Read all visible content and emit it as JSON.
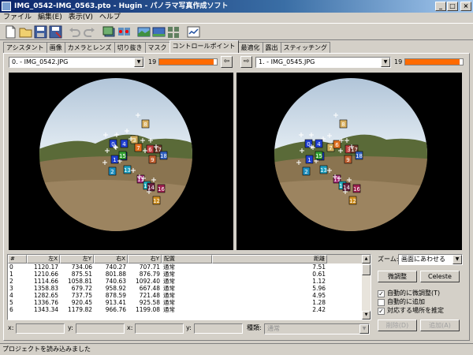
{
  "window": {
    "title": "IMG_0542-IMG_0563.pto - Hugin - パノラマ写真作成ソフト",
    "minimize": "_",
    "maximize": "□",
    "close": "×"
  },
  "menu": [
    "ファイル",
    "編集(E)",
    "表示(V)",
    "ヘルプ"
  ],
  "toolbar": [
    "new-project",
    "open-project",
    "save-project",
    "save-as",
    "undo",
    "redo",
    "add-image",
    "control-points",
    "panorama-preview",
    "fast-preview",
    "layout",
    "stitch"
  ],
  "tabs": [
    "アシスタント",
    "画像",
    "カメラとレンズ",
    "切り抜き",
    "マスク",
    "コントロールポイント",
    "最適化",
    "露出",
    "スティッチング"
  ],
  "active_tab": "コントロールポイント",
  "left_image": {
    "select": "0. - IMG_0542.JPG",
    "count": "19",
    "progress": 0.95,
    "nav": "⇦"
  },
  "right_image": {
    "select": "1. - IMG_0545.JPG",
    "count": "19",
    "progress": 0.95,
    "nav": "⇨"
  },
  "points_left": [
    "8",
    "0",
    "4",
    "3",
    "7",
    "6",
    "17",
    "5",
    "1",
    "18",
    "9",
    "2",
    "13",
    "11",
    "10",
    "14",
    "16",
    "12",
    "15"
  ],
  "points_right": [
    "8",
    "0",
    "4",
    "7",
    "6",
    "3",
    "17",
    "5",
    "1",
    "18",
    "9",
    "2",
    "13",
    "11",
    "10",
    "14",
    "16",
    "12",
    "15"
  ],
  "table": {
    "headers": [
      "#",
      "左X",
      "左Y",
      "右X",
      "右Y",
      "配置",
      "距離"
    ],
    "rows": [
      [
        "0",
        "1120.17",
        "734.06",
        "740.27",
        "707.71",
        "通常",
        "7.51"
      ],
      [
        "1",
        "1210.66",
        "875.51",
        "801.88",
        "876.79",
        "通常",
        "0.61"
      ],
      [
        "2",
        "1114.66",
        "1058.81",
        "740.63",
        "1092.40",
        "通常",
        "1.12"
      ],
      [
        "3",
        "1358.83",
        "679.72",
        "958.92",
        "667.48",
        "通常",
        "5.96"
      ],
      [
        "4",
        "1282.65",
        "737.75",
        "878.59",
        "721.48",
        "通常",
        "4.95"
      ],
      [
        "5",
        "1336.76",
        "920.45",
        "913.41",
        "925.58",
        "通常",
        "1.28"
      ],
      [
        "6",
        "1343.34",
        "1179.82",
        "966.76",
        "1199.08",
        "通常",
        "2.42"
      ]
    ]
  },
  "fields": {
    "x1": "x:",
    "y1": "y:",
    "x2": "x:",
    "y2": "y:",
    "type_label": "種類:",
    "type_value": "通常"
  },
  "side": {
    "zoom_label": "ズーム:",
    "zoom_value": "画面にあわせる",
    "fine_tune": "微調整",
    "celeste": "Celeste",
    "auto_fine_tune": "自動的に微調整(T)",
    "auto_fine_tune_checked": true,
    "auto_add": "自動的に追加",
    "auto_add_checked": false,
    "estimate": "対応する場所を推定",
    "estimate_checked": true,
    "delete": "削除(D)",
    "add": "追加(A)"
  },
  "status": "プロジェクトを読み込みました",
  "colors": {
    "progress": "#ff6a00",
    "title_start": "#0a246a",
    "title_end": "#a6caf0"
  }
}
